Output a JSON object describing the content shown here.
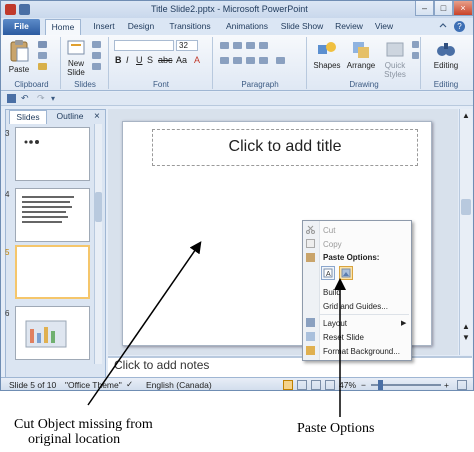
{
  "window": {
    "title": "Title Slide2.pptx - Microsoft PowerPoint",
    "controls": [
      "minimize",
      "maximize",
      "close"
    ]
  },
  "ribbon": {
    "tabs": [
      "File",
      "Home",
      "Insert",
      "Design",
      "Transitions",
      "Animations",
      "Slide Show",
      "Review",
      "View"
    ],
    "active_tab": "Home",
    "groups": {
      "clipboard": {
        "label": "Clipboard",
        "paste": "Paste"
      },
      "slides": {
        "label": "Slides",
        "new_slide_line1": "New",
        "new_slide_line2": "Slide"
      },
      "font": {
        "label": "Font",
        "size_value": "32"
      },
      "paragraph": {
        "label": "Paragraph"
      },
      "drawing": {
        "label": "Drawing",
        "shapes": "Shapes",
        "arrange": "Arrange",
        "quick_styles_line1": "Quick",
        "quick_styles_line2": "Styles"
      },
      "editing": {
        "label": "Editing",
        "editing": "Editing"
      }
    }
  },
  "left_pane": {
    "tabs": [
      "Slides",
      "Outline"
    ],
    "close_glyph": "×",
    "slides": [
      {
        "number": "3"
      },
      {
        "number": "4"
      },
      {
        "number": "5",
        "selected": true
      },
      {
        "number": "6"
      }
    ]
  },
  "slide": {
    "title_placeholder": "Click to add title"
  },
  "notes": {
    "placeholder": "Click to add notes"
  },
  "status_bar": {
    "slide_info": "Slide 5 of 10",
    "theme": "\"Office Theme\"",
    "language": "English (Canada)",
    "zoom": "47%"
  },
  "context_menu": {
    "items": {
      "cut": "Cut",
      "copy": "Copy",
      "paste_options": "Paste Options:",
      "build": "Build",
      "grid_and_guides": "Grid and Guides...",
      "layout": "Layout",
      "reset_slide": "Reset Slide",
      "format_background": "Format Background..."
    }
  },
  "annotations": {
    "cut_line1": "Cut Object missing from",
    "cut_line2": "original location",
    "paste": "Paste Options"
  },
  "colors": {
    "accent": "#2b5aa0",
    "ribbon_bg": "#dfe8f4",
    "selection": "#f5c66b"
  }
}
